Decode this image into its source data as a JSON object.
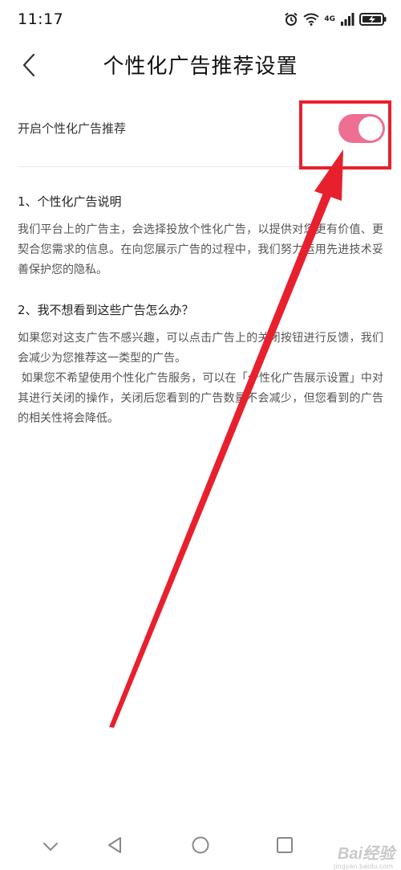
{
  "status_bar": {
    "time": "11:17",
    "network_label": "4G",
    "icons": [
      "alarm-icon",
      "wifi-icon",
      "signal-icon",
      "battery-icon"
    ]
  },
  "header": {
    "title": "个性化广告推荐设置",
    "back_icon": "chevron-left-icon"
  },
  "setting": {
    "label": "开启个性化广告推荐",
    "enabled": true,
    "toggle_color": "#ee6f94"
  },
  "sections": [
    {
      "heading": "1、个性化广告说明",
      "body": "我们平台上的广告主，会选择投放个性化广告，以提供对您更有价值、更契合您需求的信息。在向您展示广告的过程中，我们努力运用先进技术妥善保护您的隐私。"
    },
    {
      "heading": "2、我不想看到这些广告怎么办？",
      "body": "如果您对这支广告不感兴趣，可以点击广告上的关闭按钮进行反馈，我们会减少为您推荐这一类型的广告。",
      "body2": " 如果您不希望使用个性化广告服务，可以在「个性化广告展示设置」中对其进行关闭的操作，关闭后您看到的广告数量不会减少，但您看到的广告的相关性将会降低。"
    }
  ],
  "annotation": {
    "highlight_color": "#e8202e"
  },
  "nav_bar": {
    "icons": [
      "chevron-down-icon",
      "back-triangle-icon",
      "home-circle-icon",
      "recents-square-icon"
    ]
  },
  "watermark": {
    "text": "Bai经验",
    "sub": "jingyan.baidu.com"
  }
}
